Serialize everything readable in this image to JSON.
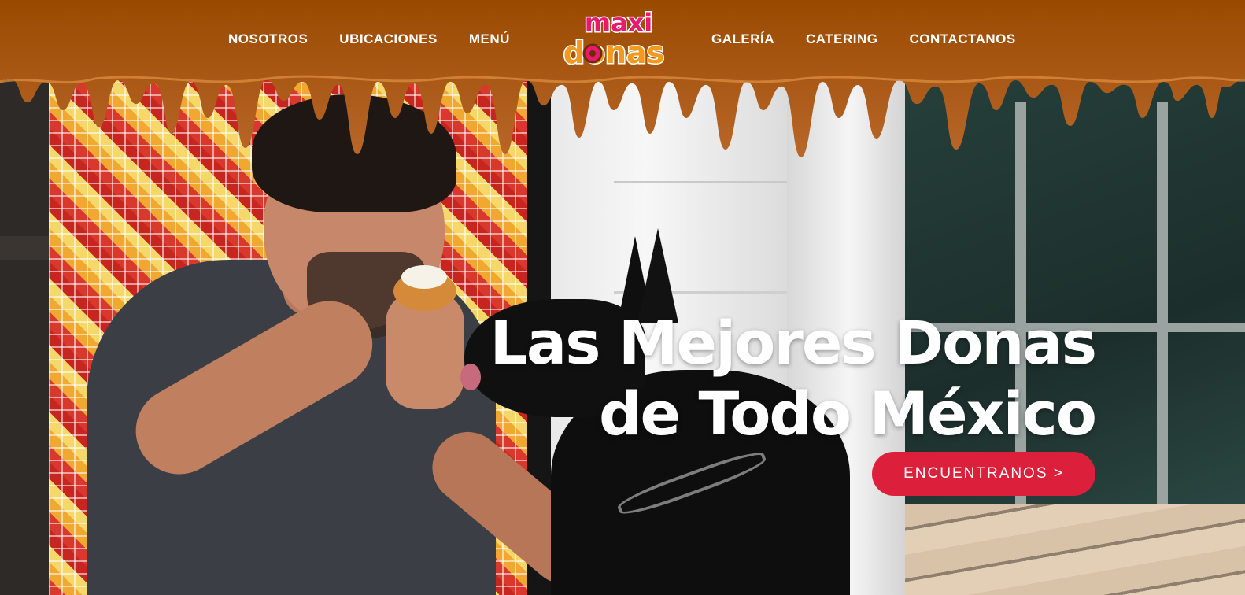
{
  "nav": {
    "left": [
      "NOSOTROS",
      "UBICACIONES",
      "MENÚ"
    ],
    "right": [
      "GALERÍA",
      "CATERING",
      "CONTACTANOS"
    ]
  },
  "logo": {
    "line1": "maxi",
    "line2": "donas"
  },
  "hero": {
    "headline_line1": "Las Mejores Donas",
    "headline_line2": "de Todo México",
    "cta_label": "ENCUENTRANOS >"
  },
  "colors": {
    "header_chocolate": "#9a4a00",
    "drip_caramel": "#c0702a",
    "cta_red": "#dc1f3a",
    "logo_pink": "#e8196e",
    "logo_orange": "#f39a1e"
  }
}
